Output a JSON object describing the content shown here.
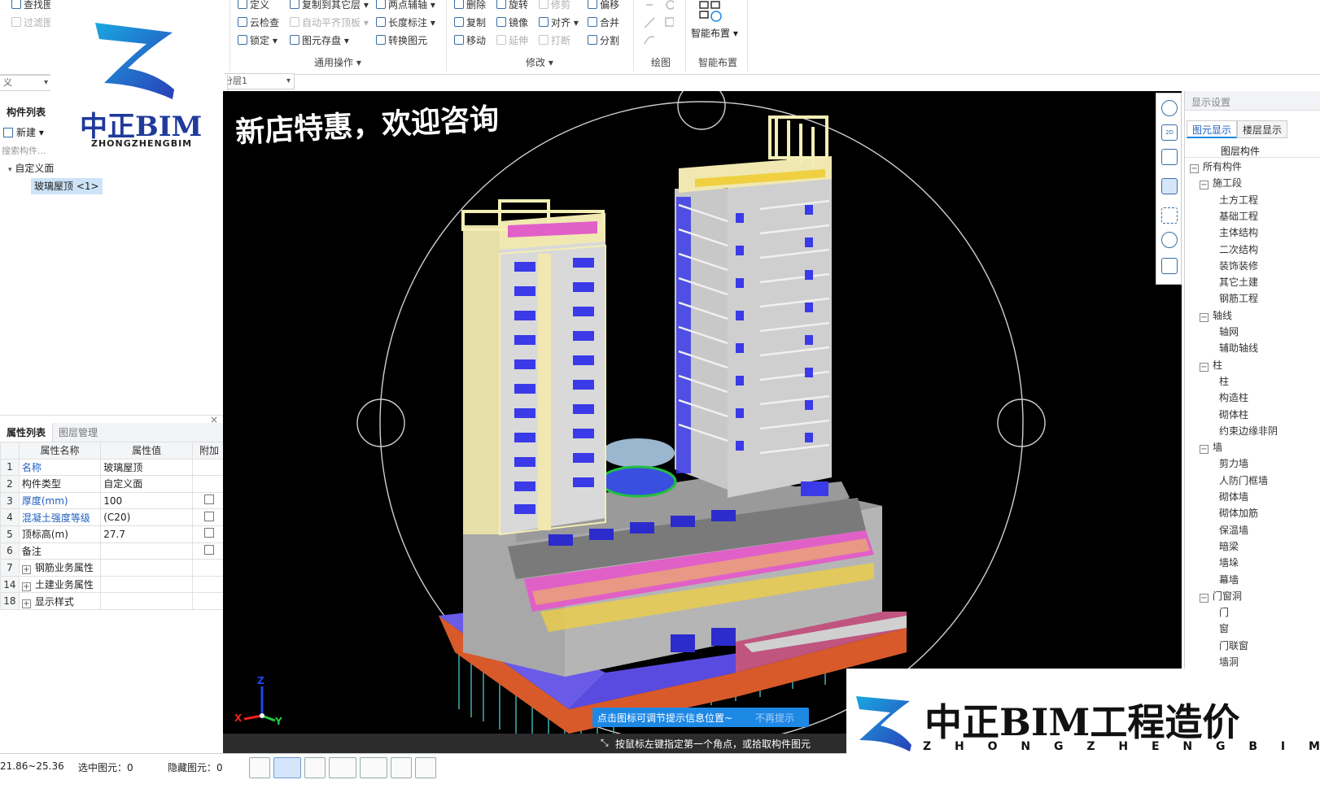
{
  "ribbon": {
    "col0": [
      {
        "label": "查找图",
        "disabled": false
      },
      {
        "label": "过滤图",
        "disabled": true
      }
    ],
    "col1": [
      {
        "label": "定义",
        "disabled": false
      },
      {
        "label": "云检查",
        "disabled": false
      },
      {
        "label": "锁定 ▾",
        "disabled": false
      }
    ],
    "col2": [
      {
        "label": "复制到其它层 ▾",
        "disabled": false
      },
      {
        "label": "自动平齐顶板 ▾",
        "disabled": true
      },
      {
        "label": "图元存盘 ▾",
        "disabled": false
      }
    ],
    "col3": [
      {
        "label": "两点辅轴 ▾",
        "disabled": false
      },
      {
        "label": "长度标注 ▾",
        "disabled": false
      },
      {
        "label": "转换图元",
        "disabled": false
      }
    ],
    "group_general": "通用操作 ▾",
    "col4": [
      {
        "label": "删除",
        "disabled": false
      },
      {
        "label": "复制",
        "disabled": false
      },
      {
        "label": "移动",
        "disabled": false
      }
    ],
    "col5": [
      {
        "label": "旋转",
        "disabled": false
      },
      {
        "label": "镜像",
        "disabled": false
      },
      {
        "label": "延伸",
        "disabled": true
      }
    ],
    "col6": [
      {
        "label": "修剪",
        "disabled": true
      },
      {
        "label": "对齐 ▾",
        "disabled": false
      },
      {
        "label": "打断",
        "disabled": true
      }
    ],
    "col7": [
      {
        "label": "偏移",
        "disabled": false
      },
      {
        "label": "合并",
        "disabled": false
      },
      {
        "label": "分割",
        "disabled": false
      }
    ],
    "group_modify": "修改 ▾",
    "group_draw": "绘图",
    "smart_layout_button": "智能布置 ▾",
    "group_smart": "智能布置"
  },
  "layer_dropdown": "分层1",
  "left_dropdown": "义",
  "component_list": {
    "tab": "构件列表",
    "new_button": "新建 ▾",
    "search_placeholder": "搜索构件...",
    "tree_root": "自定义面",
    "tree_item": "玻璃屋顶 <1>"
  },
  "logo_top": {
    "cn": "中正BIM",
    "en": "ZHONGZHENGBIM"
  },
  "property_panel": {
    "tabs": [
      "属性列表",
      "图层管理"
    ],
    "close": "×",
    "headers": [
      "属性名称",
      "属性值",
      "附加"
    ],
    "rows": [
      {
        "no": "1",
        "name": "名称",
        "value": "玻璃屋顶",
        "blue": true,
        "checkbox": false,
        "expand": false
      },
      {
        "no": "2",
        "name": "构件类型",
        "value": "自定义面",
        "blue": false,
        "checkbox": false,
        "expand": false
      },
      {
        "no": "3",
        "name": "厚度(mm)",
        "value": "100",
        "blue": true,
        "checkbox": true,
        "expand": false
      },
      {
        "no": "4",
        "name": "混凝土强度等级",
        "value": "(C20)",
        "blue": true,
        "checkbox": true,
        "expand": false
      },
      {
        "no": "5",
        "name": "顶标高(m)",
        "value": "27.7",
        "blue": false,
        "checkbox": true,
        "expand": false
      },
      {
        "no": "6",
        "name": "备注",
        "value": "",
        "blue": false,
        "checkbox": true,
        "expand": false
      },
      {
        "no": "7",
        "name": "钢筋业务属性",
        "value": "",
        "blue": false,
        "checkbox": false,
        "expand": true
      },
      {
        "no": "14",
        "name": "土建业务属性",
        "value": "",
        "blue": false,
        "checkbox": false,
        "expand": true
      },
      {
        "no": "18",
        "name": "显示样式",
        "value": "",
        "blue": false,
        "checkbox": false,
        "expand": true
      }
    ]
  },
  "viewport": {
    "promo_text": "新店特惠，欢迎咨询",
    "hint_banner": "点击图标可调节提示信息位置~",
    "hint_dismiss": "不再提示",
    "command_prompt": "按鼠标左键指定第一个角点，或拾取构件图元",
    "axis_x": "X",
    "axis_y": "Y",
    "axis_z": "Z"
  },
  "display_settings": {
    "title": "显示设置",
    "tabs": [
      "图元显示",
      "楼层显示"
    ],
    "column_header": "图层构件",
    "tree": [
      {
        "label": "所有构件",
        "level": 0,
        "expander": "−"
      },
      {
        "label": "施工段",
        "level": 1,
        "expander": "−"
      },
      {
        "label": "土方工程",
        "level": 2,
        "expander": ""
      },
      {
        "label": "基础工程",
        "level": 2,
        "expander": ""
      },
      {
        "label": "主体结构",
        "level": 2,
        "expander": ""
      },
      {
        "label": "二次结构",
        "level": 2,
        "expander": ""
      },
      {
        "label": "装饰装修",
        "level": 2,
        "expander": ""
      },
      {
        "label": "其它土建",
        "level": 2,
        "expander": ""
      },
      {
        "label": "钢筋工程",
        "level": 2,
        "expander": ""
      },
      {
        "label": "轴线",
        "level": 1,
        "expander": "−"
      },
      {
        "label": "轴网",
        "level": 2,
        "expander": ""
      },
      {
        "label": "辅助轴线",
        "level": 2,
        "expander": ""
      },
      {
        "label": "柱",
        "level": 1,
        "expander": "−"
      },
      {
        "label": "柱",
        "level": 2,
        "expander": ""
      },
      {
        "label": "构造柱",
        "level": 2,
        "expander": ""
      },
      {
        "label": "砌体柱",
        "level": 2,
        "expander": ""
      },
      {
        "label": "约束边缘非阴",
        "level": 2,
        "expander": ""
      },
      {
        "label": "墙",
        "level": 1,
        "expander": "−"
      },
      {
        "label": "剪力墙",
        "level": 2,
        "expander": ""
      },
      {
        "label": "人防门框墙",
        "level": 2,
        "expander": ""
      },
      {
        "label": "砌体墙",
        "level": 2,
        "expander": ""
      },
      {
        "label": "砌体加筋",
        "level": 2,
        "expander": ""
      },
      {
        "label": "保温墙",
        "level": 2,
        "expander": ""
      },
      {
        "label": "暗梁",
        "level": 2,
        "expander": ""
      },
      {
        "label": "墙垛",
        "level": 2,
        "expander": ""
      },
      {
        "label": "幕墙",
        "level": 2,
        "expander": ""
      },
      {
        "label": "门窗洞",
        "level": 1,
        "expander": "−"
      },
      {
        "label": "门",
        "level": 2,
        "expander": ""
      },
      {
        "label": "窗",
        "level": 2,
        "expander": ""
      },
      {
        "label": "门联窗",
        "level": 2,
        "expander": ""
      },
      {
        "label": "墙洞",
        "level": 2,
        "expander": ""
      }
    ]
  },
  "status_bar": {
    "coords": "21.86~25.36",
    "selected": "选中图元：0",
    "hidden": "隐藏图元：0"
  },
  "watermark": {
    "cn": "中正BIM工程造价",
    "en": "Z H O N G Z H E N G B I M"
  },
  "colors": {
    "brand_blue": "#1f4fbf",
    "viewport_bg": "#000000",
    "hint_blue": "#1e88e5"
  }
}
